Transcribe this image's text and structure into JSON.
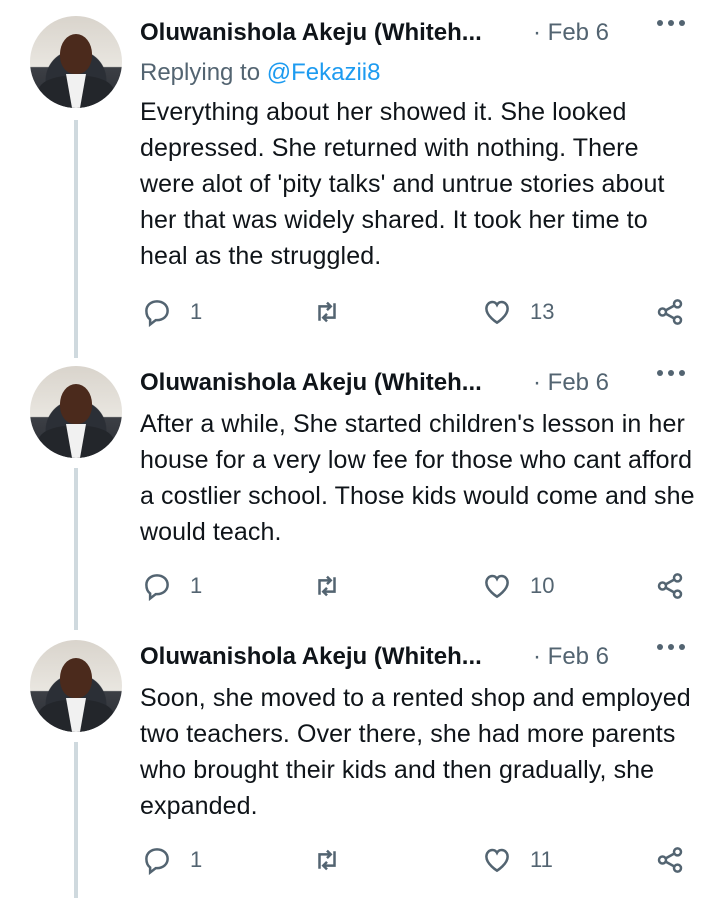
{
  "tweets": [
    {
      "author": "Oluwanishola Akeju (Whiteh...",
      "date": "· Feb 6",
      "replying_label": "Replying to ",
      "replying_handle": "@Fekazii8",
      "text": "Everything about her showed it. She looked depressed. She returned with nothing. There were alot of 'pity talks' and untrue stories about her that was widely shared. It took her time to heal as the struggled.",
      "replies": "1",
      "retweets": "",
      "likes": "13"
    },
    {
      "author": "Oluwanishola Akeju (Whiteh...",
      "date": "· Feb 6",
      "text": "After a while, She started children's lesson in her house for a very low fee for those who cant afford a costlier school. Those kids would come and she would teach.",
      "replies": "1",
      "retweets": "",
      "likes": "10"
    },
    {
      "author": "Oluwanishola Akeju (Whiteh...",
      "date": "· Feb 6",
      "text": "Soon, she moved to a rented shop and employed two teachers. Over there, she had more parents who brought their kids and then gradually, she expanded.",
      "replies": "1",
      "retweets": "",
      "likes": "11"
    }
  ],
  "icons": {
    "reply": "reply-icon",
    "retweet": "retweet-icon",
    "like": "heart-icon",
    "share": "share-icon",
    "more": "more-icon"
  },
  "colors": {
    "secondary_text": "#536471",
    "link": "#1d9bf0",
    "thread_line": "#cfd9de"
  }
}
